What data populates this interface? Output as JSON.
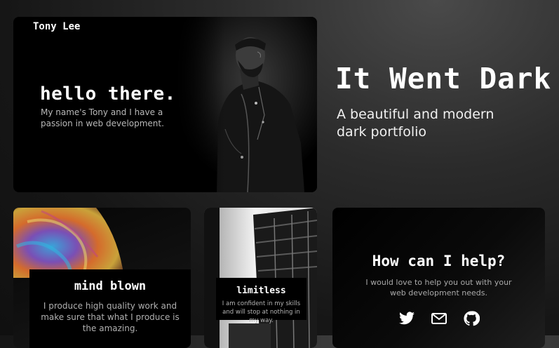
{
  "hero": {
    "name": "Tony Lee",
    "greeting": "hello there.",
    "intro": "My name's Tony and I have a passion in web development."
  },
  "tagline": {
    "title": "It Went Dark",
    "subtitle": "A beautiful and modern dark portfolio"
  },
  "cards": {
    "mind": {
      "title": "mind blown",
      "text": "I produce high quality work and make sure that what I produce is the amazing."
    },
    "limit": {
      "title": "limitless",
      "text": "I am confident in my skills and will stop at nothing in my way."
    },
    "help": {
      "title": "How can I help?",
      "text": "I would love to help you out with your web development needs."
    }
  },
  "socials": {
    "icons": [
      "twitter-icon",
      "mail-icon",
      "github-icon"
    ]
  },
  "colors": {
    "background": "#1a1a1a",
    "card": "#000000",
    "text": "#ffffff",
    "muted_text": "#b0b0b0"
  }
}
